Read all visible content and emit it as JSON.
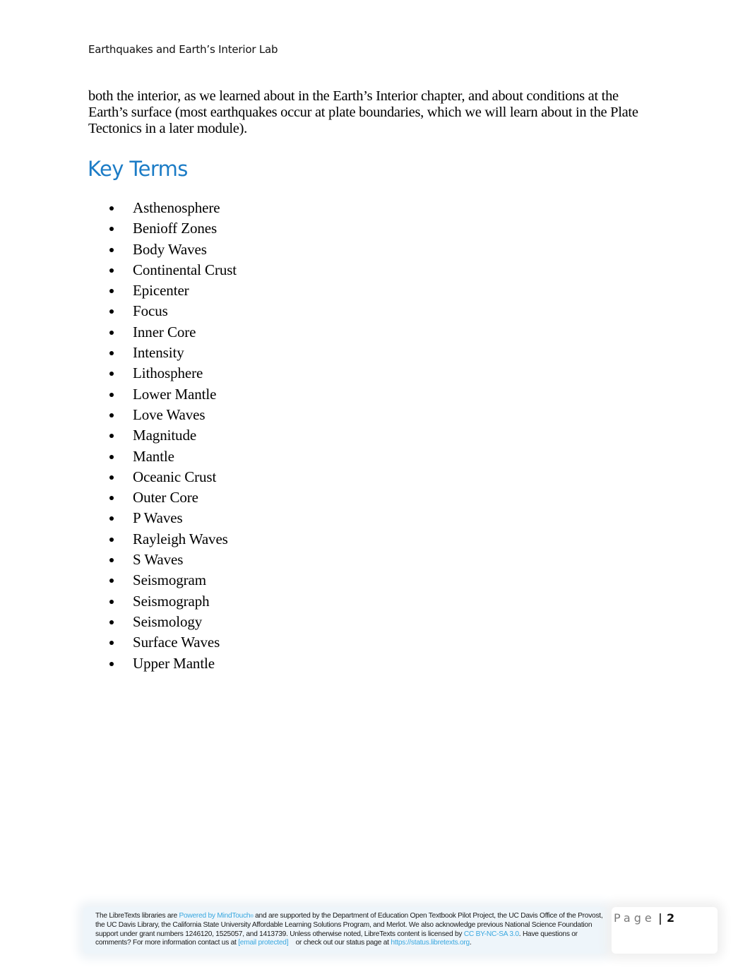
{
  "header": {
    "running_title": "Earthquakes and Earth’s Interior Lab"
  },
  "intro": {
    "text": "both the interior, as we learned about in the Earth’s Interior chapter, and about conditions at the Earth’s surface (most earthquakes occur at plate boundaries, which we will learn about in the Plate Tectonics in a later module)."
  },
  "key_terms": {
    "heading": "Key Terms",
    "heading_color": "#1c7cc6",
    "items": [
      "Asthenosphere",
      "Benioff Zones",
      "Body Waves",
      "Continental Crust",
      "Epicenter",
      "Focus",
      "Inner Core",
      "Intensity",
      "Lithosphere",
      "Lower Mantle",
      "Love Waves",
      "Magnitude",
      "Mantle",
      "Oceanic Crust",
      "Outer Core",
      "P Waves",
      "Rayleigh Waves",
      "S Waves",
      "Seismogram",
      "Seismograph",
      "Seismology",
      "Surface Waves",
      "Upper Mantle"
    ]
  },
  "footer": {
    "link_color": "#3aa8e0",
    "text_1": "The LibreTexts libraries are ",
    "link_mindtouch": "Powered by MindTouch",
    "reg_mark": "®",
    "text_2": " and are supported by the Department of Education Open Textbook Pilot Project, the UC Davis Office of the Provost, the UC Davis Library, the California State University Affordable Learning Solutions Program, and Merlot. We also acknowledge previous National Science Foundation support under grant numbers 1246120, 1525057, and 1413739. Unless otherwise noted, LibreTexts content is licensed by ",
    "link_license": "CC BY-NC-SA 3.0",
    "text_3": ". Have questions or comments? For more information contact us at ",
    "link_email": "[email protected]",
    "text_4": "    or check out our status page at ",
    "link_status": "https://status.libretexts.org",
    "text_5": "."
  },
  "page": {
    "label": "Page",
    "separator": "|",
    "number": "2"
  }
}
